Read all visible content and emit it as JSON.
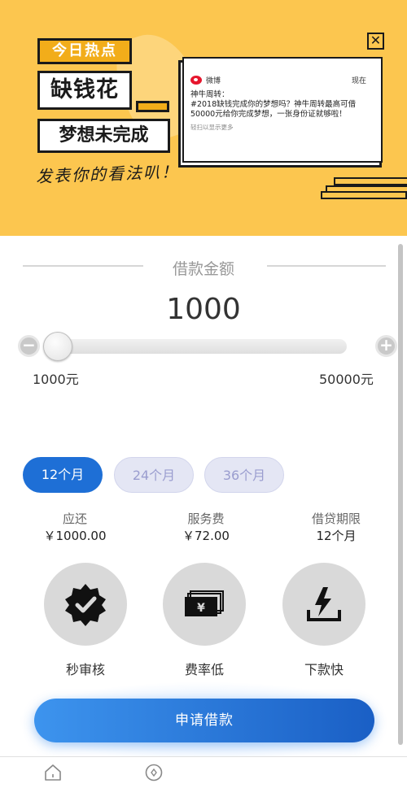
{
  "banner": {
    "hot_tag": "今日热点",
    "title": "缺钱花",
    "subtitle": "梦想未完成",
    "call_to_action": "发表你的看法叭！",
    "close_icon": "close-icon",
    "post": {
      "source": "微博",
      "time": "现在",
      "author": "神牛周转：",
      "line1": "#2018缺钱完成你的梦想吗？神牛周转最高可借",
      "line2": "50000元给你完成梦想，一张身份证就够啦！",
      "footer": "轻扫以显示更多"
    }
  },
  "loan": {
    "title": "借款金额",
    "amount": "1000",
    "slider_value_fraction": 0.0,
    "min_label": "1000元",
    "max_label": "50000元",
    "minus_symbol": "−",
    "plus_symbol": "+"
  },
  "terms": {
    "options": [
      "12个月",
      "24个月",
      "36个月"
    ],
    "selected": "12个月"
  },
  "summary": {
    "repay_label": "应还",
    "repay_value": "￥1000.00",
    "fee_label": "服务费",
    "fee_value": "￥72.00",
    "period_label": "借贷期限",
    "period_value": "12个月"
  },
  "features": [
    {
      "label": "秒审核",
      "icon": "verified-badge-icon"
    },
    {
      "label": "费率低",
      "icon": "cash-stack-icon"
    },
    {
      "label": "下款快",
      "icon": "lightning-tray-icon"
    }
  ],
  "cta": {
    "label": "申请借款"
  },
  "bottom_nav": {
    "items": [
      {
        "icon": "home-icon"
      },
      {
        "icon": "discover-icon"
      }
    ]
  },
  "colors": {
    "banner_bg": "#fcc64f",
    "primary_blue": "#1e6fd6",
    "tab_inactive_bg": "#e4e6f4",
    "feature_circle": "#d9d9d9"
  }
}
